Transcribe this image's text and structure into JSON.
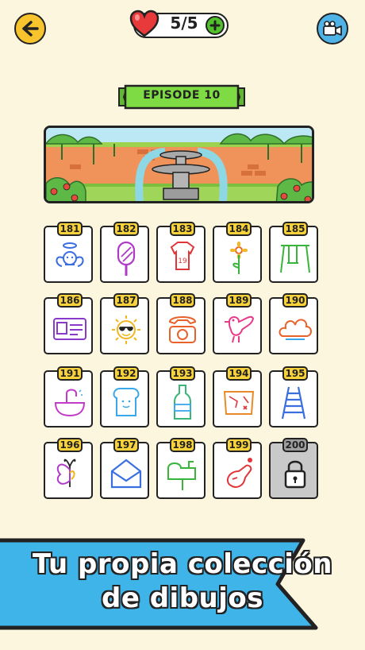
{
  "header": {
    "back_icon": "arrow-left-icon",
    "lives_text": "5/5",
    "heart_icon": "heart-icon",
    "add_icon": "plus-icon",
    "video_icon": "video-camera-icon"
  },
  "episode": {
    "title": "EPISODE 10"
  },
  "levels": [
    {
      "number": "181",
      "drawing": "angel-drawing",
      "color": "#3B6FE0"
    },
    {
      "number": "182",
      "drawing": "ice-cream-drawing",
      "color": "#B03AC8"
    },
    {
      "number": "183",
      "drawing": "tshirt-19-drawing",
      "color": "#E0363A"
    },
    {
      "number": "184",
      "drawing": "flower-drawing",
      "color": "#F0B61E"
    },
    {
      "number": "185",
      "drawing": "swing-drawing",
      "color": "#38B53A"
    },
    {
      "number": "186",
      "drawing": "id-card-drawing",
      "color": "#8A3AC8"
    },
    {
      "number": "187",
      "drawing": "sun-sunglasses-drawing",
      "color": "#F0B61E"
    },
    {
      "number": "188",
      "drawing": "telephone-drawing",
      "color": "#E8622A"
    },
    {
      "number": "189",
      "drawing": "bird-drawing",
      "color": "#E83A8A"
    },
    {
      "number": "190",
      "drawing": "cloud-drawing",
      "color": "#E8622A"
    },
    {
      "number": "191",
      "drawing": "sink-drawing",
      "color": "#C23AC8"
    },
    {
      "number": "192",
      "drawing": "toast-drawing",
      "color": "#3AA8E8"
    },
    {
      "number": "193",
      "drawing": "bottle-drawing",
      "color": "#3AB57A"
    },
    {
      "number": "194",
      "drawing": "treasure-map-drawing",
      "color": "#E88A2A"
    },
    {
      "number": "195",
      "drawing": "ladder-drawing",
      "color": "#3A6FE0"
    },
    {
      "number": "196",
      "drawing": "butterfly-drawing",
      "color": "#B03AC8"
    },
    {
      "number": "197",
      "drawing": "envelope-drawing",
      "color": "#3A6FE0"
    },
    {
      "number": "198",
      "drawing": "mailbox-drawing",
      "color": "#38B53A"
    },
    {
      "number": "199",
      "drawing": "ham-drawing",
      "color": "#E0363A"
    },
    {
      "number": "200",
      "drawing": "lock-icon",
      "locked": true
    }
  ],
  "promo": {
    "line1": "Tu propia colección",
    "line2": "de dibujos"
  },
  "colors": {
    "background": "#FCF6DF",
    "accent_yellow": "#F8C42E",
    "ribbon_green": "#7EDB43",
    "promo_blue": "#3FB4E8"
  }
}
